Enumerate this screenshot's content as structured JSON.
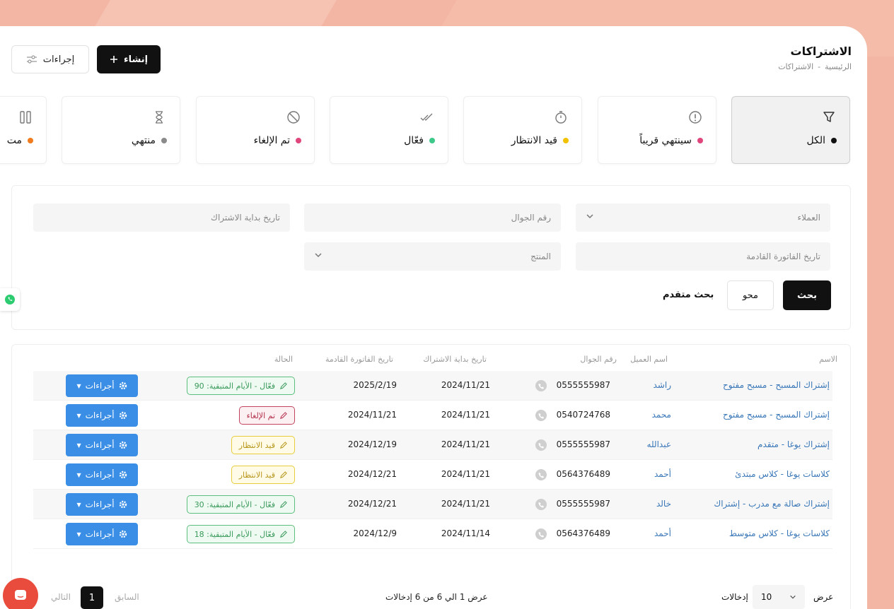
{
  "header": {
    "title": "الاشتراكات",
    "breadcrumb": [
      "الرئيسية",
      "-",
      "الاشتراكات"
    ],
    "create_label": "إنشاء",
    "actions_label": "إجراءات"
  },
  "tabs": [
    {
      "label": "الكل",
      "dot": "#111111",
      "icon": "filter-icon",
      "active": true
    },
    {
      "label": "سينتهي قريباً",
      "dot": "#e0457b",
      "icon": "alert-circle-icon"
    },
    {
      "label": "قيد الانتظار",
      "dot": "#f2c200",
      "icon": "stopwatch-icon"
    },
    {
      "label": "فعّال",
      "dot": "#3cc98a",
      "icon": "double-check-icon"
    },
    {
      "label": "تم الإلغاء",
      "dot": "#e0457b",
      "icon": "ban-icon"
    },
    {
      "label": "منتهي",
      "dot": "#8a8a8a",
      "icon": "hourglass-icon"
    },
    {
      "label": "مت",
      "dot": "#f07c1f",
      "icon": "pause-icon"
    }
  ],
  "search": {
    "clients_placeholder": "العملاء",
    "phone_placeholder": "رقم الجوال",
    "start_date_placeholder": "تاريخ بداية الاشتراك",
    "next_invoice_placeholder": "تاريخ الفاتورة القادمة",
    "product_placeholder": "المنتج",
    "search_label": "بحث",
    "clear_label": "محو",
    "advanced_label": "بحث متقدم"
  },
  "table": {
    "headers": {
      "name": "الاسم",
      "client": "اسم العميل",
      "phone": "رقم الجوال",
      "start": "تاريخ بداية الاشتراك",
      "next": "تاريخ الفاتورة القادمة",
      "status": "الحالة"
    },
    "action_label": "أجراءات",
    "rows": [
      {
        "name": "إشتراك المسبح - مسبح مفتوح",
        "client": "راشد",
        "phone": "0555555987",
        "start": "2024/11/21",
        "next": "2025/2/19",
        "status": "فعّال - الأيام المتبقية: 90",
        "status_type": "green"
      },
      {
        "name": "إشتراك المسبح - مسبح مفتوح",
        "client": "محمد",
        "phone": "0540724768",
        "start": "2024/11/21",
        "next": "2024/11/21",
        "status": "تم الإلغاء",
        "status_type": "red"
      },
      {
        "name": "إشتراك يوغا - متقدم",
        "client": "عبدالله",
        "phone": "0555555987",
        "start": "2024/11/21",
        "next": "2024/12/19",
        "status": "قيد الانتظار",
        "status_type": "yellow"
      },
      {
        "name": "كلاسات يوغا - كلاس مبتدئ",
        "client": "أحمد",
        "phone": "0564376489",
        "start": "2024/11/21",
        "next": "2024/12/21",
        "status": "قيد الانتظار",
        "status_type": "yellow"
      },
      {
        "name": "إشتراك صالة مع مدرب - إشتراك",
        "client": "خالد",
        "phone": "0555555987",
        "start": "2024/11/21",
        "next": "2024/12/21",
        "status": "فعّال - الأيام المتبقية: 30",
        "status_type": "green"
      },
      {
        "name": "كلاسات يوغا - كلاس متوسط",
        "client": "أحمد",
        "phone": "0564376489",
        "start": "2024/11/14",
        "next": "2024/12/9",
        "status": "فعّال - الأيام المتبقية: 18",
        "status_type": "green"
      }
    ]
  },
  "pagination": {
    "info": "عرض 1 الي 6 من 6 إدخالات",
    "show_label": "عرض",
    "page_size": "10",
    "entries_label": "إدخالات",
    "current_page": "1",
    "prev_label": "السابق",
    "next_label": "التالي"
  }
}
